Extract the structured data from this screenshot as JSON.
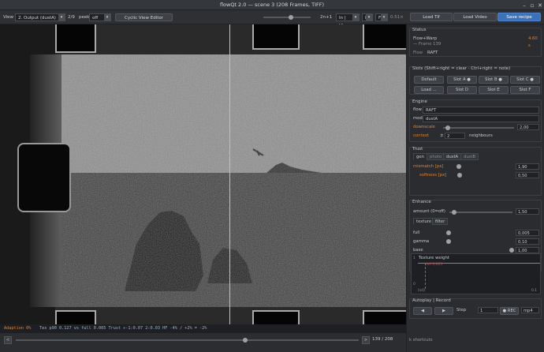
{
  "window": {
    "title": "flowQt 2.0 — scene 3  (208 Frames, TIFF)"
  },
  "toolbar": {
    "view_label": "View",
    "view_value": "2. Output (dustA)",
    "frame_step": "2/9",
    "peek_label": "peek",
    "peek_value": "off",
    "cyclic_button": "Cyclic View Editor",
    "zoom_label": "2n+1",
    "in_view": "In | View",
    "in_label": "In",
    "fit_label": "Fit",
    "fit_value": "0.51×"
  },
  "top_right": {
    "load_tif": "Load Tif",
    "load_video": "Load Video",
    "save_recipe": "Save recipe"
  },
  "status": {
    "title": "Status",
    "line1": "Flow+Warp",
    "time": "4.60 s",
    "line2": "— Frame 139",
    "flow_label": "Flow",
    "flow_value": "RAFT"
  },
  "slots": {
    "title": "Slots  (Shift+right = clear · Ctrl+right = note)",
    "buttons": [
      "Default",
      "Slot A ●",
      "Slot B ●",
      "Slot C ●",
      "Load ...",
      "Slot D",
      "Slot E",
      "Slot F"
    ]
  },
  "engine": {
    "title": "Engine",
    "flow_label": "flow",
    "flow_value": "RAFT",
    "mode_label": "mode",
    "mode_value": "dustA",
    "downscale_label": "downscale",
    "downscale_value": "2,00",
    "context_label": "context",
    "context_prefix": "±",
    "context_value": "2",
    "context_suffix": "neighbours"
  },
  "trust": {
    "title": "Trust",
    "tabs": [
      "gen",
      "photo",
      "dustA",
      "dustB"
    ],
    "mismatch_label": "mismatch [px]",
    "mismatch_value": "1,90",
    "softness_label": "softness [px]",
    "softness_value": "0,50"
  },
  "enhance": {
    "title": "Enhance",
    "amount_label": "amount (0=off)",
    "amount_value": "1,50",
    "tabs": [
      "texture",
      "filter"
    ],
    "full_label": "full",
    "full_value": "0,005",
    "gamma_label": "gamma",
    "gamma_value": "0,10",
    "base_label": "base",
    "base_value": "1,00"
  },
  "texture_plot": {
    "title": "Texture weight",
    "marker_label": "full 0,005",
    "y_top": "1",
    "y_bottom": "0",
    "x_left": "[sd]",
    "x_right": "0.1"
  },
  "autoplay": {
    "title": "Autoplay | Record",
    "prev": "◀",
    "next": "▶",
    "step_label": "Step",
    "step_value": "1",
    "rec_label": "● REC",
    "format": "mp4"
  },
  "statusbar": {
    "adaption": "Adaption 0%",
    "metrics": "Tex p90 0.127 vs full 0.005    Trust ÷-1:0.07  2:0.03    HF -4% / +2% = -2%"
  },
  "timeline": {
    "counter": "139 / 208",
    "progress": 0.668
  },
  "shortcuts": "shortcuts",
  "colors": {
    "accent": "#3b72b8",
    "marker": "#e6d200",
    "warning": "#d8863b",
    "rec_red": "#d14646"
  }
}
